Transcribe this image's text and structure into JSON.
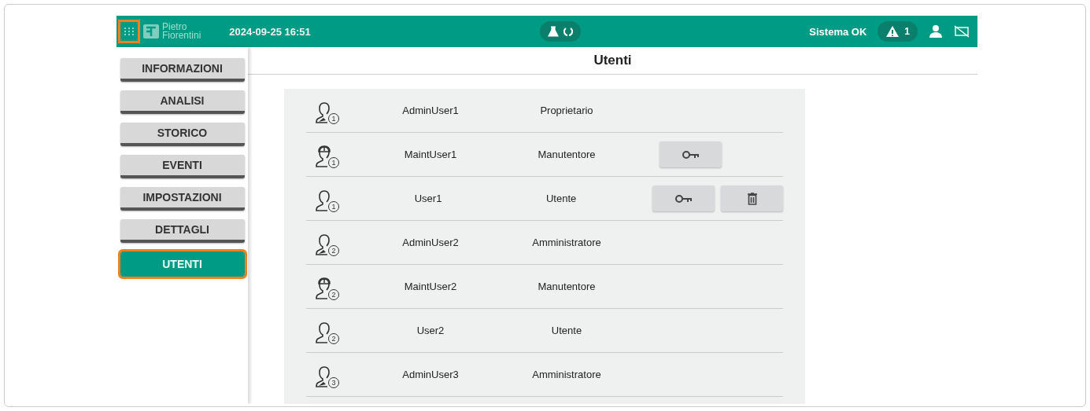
{
  "header": {
    "menu_button": {
      "highlighted": true
    },
    "logo": {
      "line1": "Pietro",
      "line2": "Fiorentini"
    },
    "datetime": "2024-09-25 16:51",
    "status": "Sistema OK",
    "alarm_count": "1"
  },
  "sidebar": {
    "items": [
      {
        "label": "INFORMAZIONI",
        "selected": false,
        "highlighted": false
      },
      {
        "label": "ANALISI",
        "selected": false,
        "highlighted": false
      },
      {
        "label": "STORICO",
        "selected": false,
        "highlighted": false
      },
      {
        "label": "EVENTI",
        "selected": false,
        "highlighted": false
      },
      {
        "label": "IMPOSTAZIONI",
        "selected": false,
        "highlighted": false
      },
      {
        "label": "DETTAGLI",
        "selected": false,
        "highlighted": false
      },
      {
        "label": "UTENTI",
        "selected": true,
        "highlighted": true
      }
    ]
  },
  "page": {
    "title": "Utenti"
  },
  "users": [
    {
      "kind": "admin",
      "badge": "1",
      "name": "AdminUser1",
      "role": "Proprietario"
    },
    {
      "kind": "maint",
      "badge": "1",
      "name": "MaintUser1",
      "role": "Manutentore",
      "actions": [
        {
          "kind": "key"
        }
      ]
    },
    {
      "kind": "user",
      "badge": "1",
      "name": "User1",
      "role": "Utente",
      "actions": [
        {
          "kind": "key"
        },
        {
          "kind": "delete"
        }
      ]
    },
    {
      "kind": "admin",
      "badge": "2",
      "name": "AdminUser2",
      "role": "Amministratore"
    },
    {
      "kind": "maint",
      "badge": "2",
      "name": "MaintUser2",
      "role": "Manutentore"
    },
    {
      "kind": "user",
      "badge": "2",
      "name": "User2",
      "role": "Utente"
    },
    {
      "kind": "admin",
      "badge": "3",
      "name": "AdminUser3",
      "role": "Amministratore"
    }
  ]
}
